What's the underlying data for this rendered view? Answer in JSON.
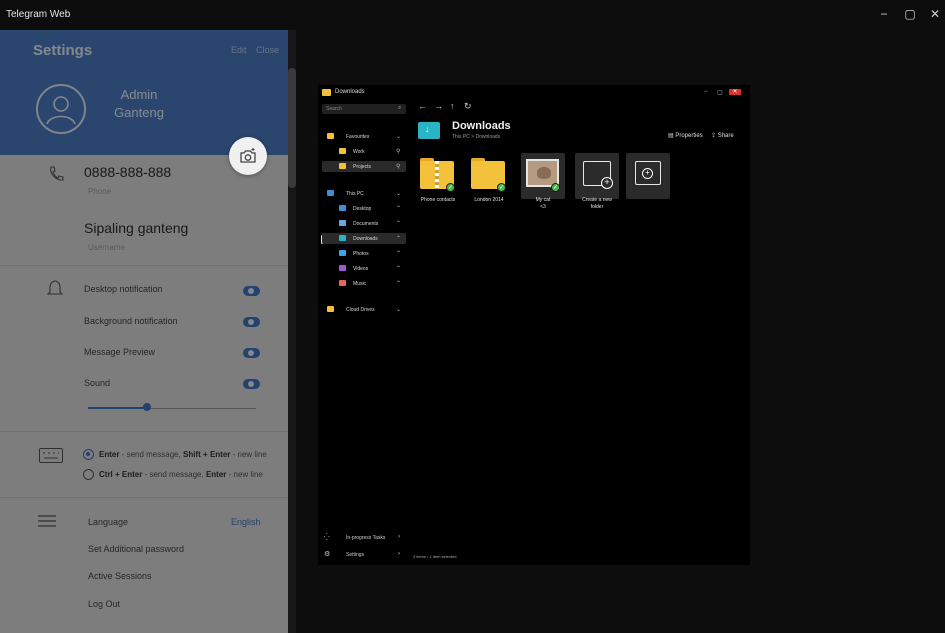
{
  "window": {
    "title": "Telegram Web",
    "controls": [
      "−",
      "▢",
      "✕"
    ]
  },
  "settings": {
    "title": "Settings",
    "edit_label": "Edit",
    "close_label": "Close",
    "profile": {
      "name_line1": "Admin",
      "name_line2": "Ganteng"
    },
    "phone": {
      "value": "0888-888-888",
      "label": "Phone"
    },
    "username": {
      "value": "Sipaling ganteng",
      "label": "Username"
    },
    "notifications": [
      {
        "label": "Desktop notification",
        "enabled": true
      },
      {
        "label": "Background notification",
        "enabled": true
      },
      {
        "label": "Message Preview",
        "enabled": true
      },
      {
        "label": "Sound",
        "enabled": true
      }
    ],
    "sound_volume": 0.35,
    "send_options": [
      {
        "key1": "Enter",
        "text1": " - send message, ",
        "key2": "Shift + Enter",
        "text2": " - new line",
        "selected": true
      },
      {
        "key1": "Ctrl + Enter",
        "text1": " - send message, ",
        "key2": "Enter",
        "text2": " - new line",
        "selected": false
      }
    ],
    "language": {
      "label": "Language",
      "value": "English"
    },
    "menu_links": [
      "Set Additional password",
      "Active Sessions",
      "Log Out"
    ],
    "accent_color": "#4a7cc4"
  },
  "explorer": {
    "window_title": "Downloads",
    "window_controls": [
      "−",
      "▢",
      "✕"
    ],
    "search_placeholder": "Search",
    "nav_buttons": [
      "←",
      "→",
      "↑",
      "↻"
    ],
    "sidebar": {
      "favourites": {
        "label": "Favourites",
        "chevron": "⌄",
        "items": [
          {
            "label": "Work",
            "pin": "⚲"
          },
          {
            "label": "Projects",
            "pin": "⚲"
          }
        ]
      },
      "this_pc": {
        "label": "This PC",
        "chevron": "⌄",
        "items": [
          {
            "label": "Desktop",
            "chevron": "⌃",
            "color": "#3f8fd6"
          },
          {
            "label": "Documents",
            "chevron": "⌃",
            "color": "#6fa6e0"
          },
          {
            "label": "Downloads",
            "chevron": "⌃",
            "color": "#2bb4c6"
          },
          {
            "label": "Photos",
            "chevron": "⌃",
            "color": "#3fa2e8"
          },
          {
            "label": "Videos",
            "chevron": "⌃",
            "color": "#9b59d6"
          },
          {
            "label": "Music",
            "chevron": "⌃",
            "color": "#e36a5a"
          }
        ]
      },
      "cloud": {
        "label": "Cloud Drives",
        "chevron": "⌄"
      },
      "selected": "Downloads"
    },
    "location": {
      "title": "Downloads",
      "path": "This PC  >  Downloads"
    },
    "toolbar": {
      "properties": "Properties",
      "share": "Share"
    },
    "files": [
      {
        "name": "Phone contacts",
        "type": "zip-folder"
      },
      {
        "name": "London 2014",
        "type": "folder"
      },
      {
        "name": "My cat\n<3",
        "type": "image"
      },
      {
        "name": "Create a new\nfolder",
        "type": "new-folder"
      },
      {
        "name": "",
        "type": "new-folder-alt"
      }
    ],
    "footer": {
      "tasks": "In-progress Tasks",
      "tasks_chevron": "›",
      "settings": "Settings",
      "settings_chevron": "›",
      "status": "3 items  •  1 item selected"
    }
  }
}
